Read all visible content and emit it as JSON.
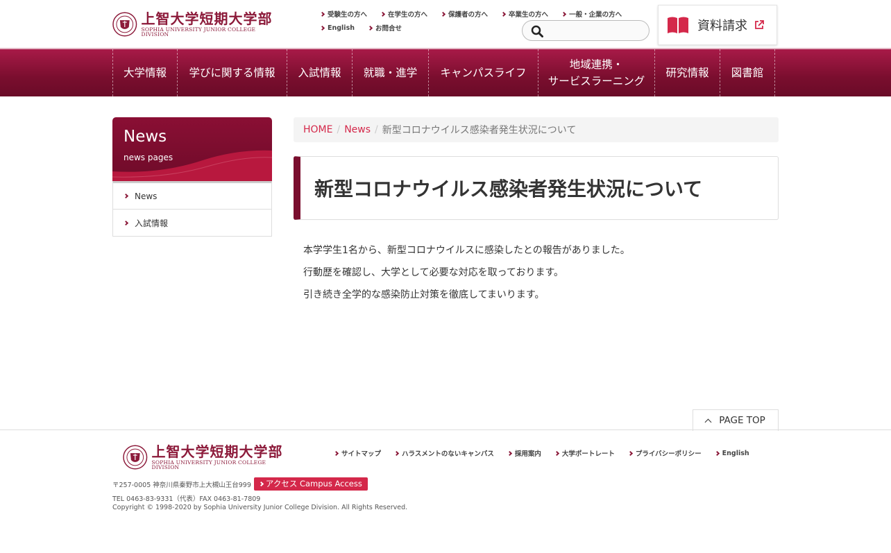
{
  "header": {
    "logo": {
      "jp": "上智大学短期大学部",
      "en": "SOPHIA UNIVERSITY JUNIOR COLLEGE DIVISION"
    },
    "util_links_row1": [
      "受験生の方へ",
      "在学生の方へ",
      "保護者の方へ",
      "卒業生の方へ",
      "一般・企業の方へ"
    ],
    "util_links_row2": [
      "English",
      "お問合せ"
    ],
    "search_placeholder": "",
    "request_button": "資料請求"
  },
  "nav": {
    "items": [
      "大学情報",
      "学びに関する情報",
      "入試情報",
      "就職・進学",
      "キャンパスライフ",
      "地域連携・サービスラーニング",
      "研究情報",
      "図書館"
    ],
    "item6_line1": "地域連携・",
    "item6_line2": "サービスラーニング"
  },
  "sidebar": {
    "title": "News",
    "subtitle": "news pages",
    "items": [
      "News",
      "入試情報"
    ]
  },
  "breadcrumb": {
    "home": "HOME",
    "section": "News",
    "current": "新型コロナウイルス感染者発生状況について"
  },
  "article": {
    "title": "新型コロナウイルス感染者発生状況について",
    "paragraphs": [
      "本学学生1名から、新型コロナウイルスに感染したとの報告がありました。",
      "行動歴を確認し、大学として必要な対応を取っております。",
      "引き続き全学的な感染防止対策を徹底してまいります。"
    ]
  },
  "page_top": "PAGE TOP",
  "footer": {
    "links": [
      "サイトマップ",
      "ハラスメントのないキャンパス",
      "採用案内",
      "大学ポートレート",
      "プライバシーポリシー",
      "English"
    ],
    "address": "〒257-0005 神奈川県秦野市上大槻山王台999",
    "access_button": "アクセス Campus Access",
    "tel": "TEL 0463-83-9331（代表）FAX 0463-81-7809",
    "copyright": "Copyright © 1998-2020 by Sophia University Junior College Division. All Rights Reserved."
  },
  "colors": {
    "brand": "#7a0e2e",
    "accent": "#d4284a"
  }
}
